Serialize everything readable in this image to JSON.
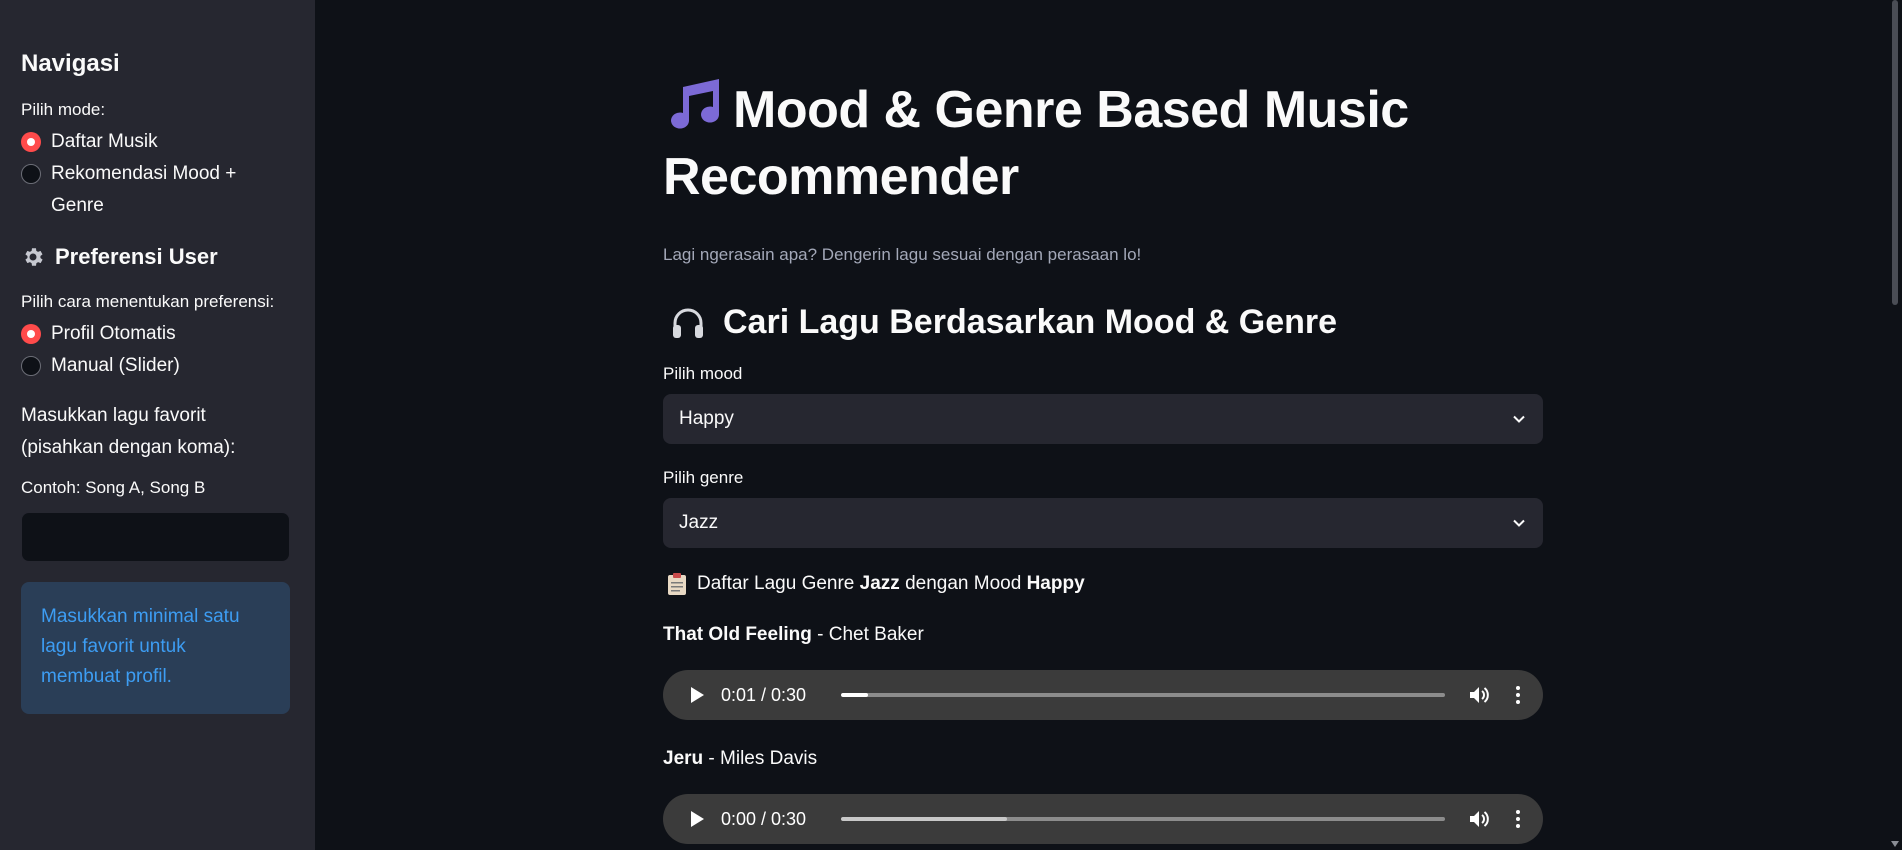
{
  "sidebar": {
    "nav_heading": "Navigasi",
    "mode_label": "Pilih mode:",
    "modes": [
      {
        "label": "Daftar Musik",
        "selected": true
      },
      {
        "label": "Rekomendasi Mood + Genre",
        "selected": false
      }
    ],
    "pref_heading": "Preferensi User",
    "pref_icon": "gear-icon",
    "pref_label": "Pilih cara menentukan preferensi:",
    "pref_options": [
      {
        "label": "Profil Otomatis",
        "selected": true
      },
      {
        "label": "Manual (Slider)",
        "selected": false
      }
    ],
    "fav_label": "Masukkan lagu favorit (pisahkan dengan koma):",
    "fav_example": "Contoh: Song A, Song B",
    "fav_value": "",
    "info_message": "Masukkan minimal satu lagu favorit untuk membuat profil."
  },
  "main": {
    "title_icon": "music-note-icon",
    "title": "Mood & Genre Based Music Recommender",
    "caption": "Lagi ngerasain apa? Dengerin lagu sesuai dengan perasaan lo!",
    "section_icon": "headphones-icon",
    "section_title": "Cari Lagu Berdasarkan Mood & Genre",
    "mood_label": "Pilih mood",
    "mood_value": "Happy",
    "genre_label": "Pilih genre",
    "genre_value": "Jazz",
    "list_prefix": "Daftar Lagu Genre",
    "list_genre": "Jazz",
    "list_middle": "dengan Mood",
    "list_mood": "Happy",
    "songs": [
      {
        "title": "That Old Feeling",
        "artist": "Chet Baker",
        "time": "0:01 / 0:30",
        "progress": 0.045
      },
      {
        "title": "Jeru",
        "artist": "Miles Davis",
        "time": "0:00 / 0:30",
        "progress": 0.275
      }
    ]
  },
  "colors": {
    "accent": "#ff4b4b",
    "background": "#0e1117",
    "sidebar": "#262730",
    "info": "#3d9df3"
  }
}
